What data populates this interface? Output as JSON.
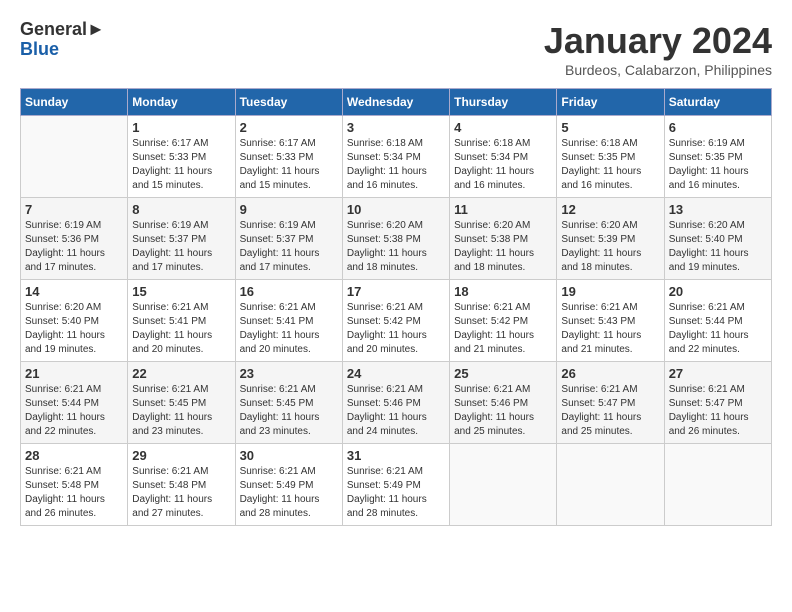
{
  "header": {
    "logo_general": "General",
    "logo_blue": "Blue",
    "month_title": "January 2024",
    "location": "Burdeos, Calabarzon, Philippines"
  },
  "days_of_week": [
    "Sunday",
    "Monday",
    "Tuesday",
    "Wednesday",
    "Thursday",
    "Friday",
    "Saturday"
  ],
  "weeks": [
    [
      {
        "day": "",
        "sunrise": "",
        "sunset": "",
        "daylight": ""
      },
      {
        "day": "1",
        "sunrise": "Sunrise: 6:17 AM",
        "sunset": "Sunset: 5:33 PM",
        "daylight": "Daylight: 11 hours and 15 minutes."
      },
      {
        "day": "2",
        "sunrise": "Sunrise: 6:17 AM",
        "sunset": "Sunset: 5:33 PM",
        "daylight": "Daylight: 11 hours and 15 minutes."
      },
      {
        "day": "3",
        "sunrise": "Sunrise: 6:18 AM",
        "sunset": "Sunset: 5:34 PM",
        "daylight": "Daylight: 11 hours and 16 minutes."
      },
      {
        "day": "4",
        "sunrise": "Sunrise: 6:18 AM",
        "sunset": "Sunset: 5:34 PM",
        "daylight": "Daylight: 11 hours and 16 minutes."
      },
      {
        "day": "5",
        "sunrise": "Sunrise: 6:18 AM",
        "sunset": "Sunset: 5:35 PM",
        "daylight": "Daylight: 11 hours and 16 minutes."
      },
      {
        "day": "6",
        "sunrise": "Sunrise: 6:19 AM",
        "sunset": "Sunset: 5:35 PM",
        "daylight": "Daylight: 11 hours and 16 minutes."
      }
    ],
    [
      {
        "day": "7",
        "sunrise": "Sunrise: 6:19 AM",
        "sunset": "Sunset: 5:36 PM",
        "daylight": "Daylight: 11 hours and 17 minutes."
      },
      {
        "day": "8",
        "sunrise": "Sunrise: 6:19 AM",
        "sunset": "Sunset: 5:37 PM",
        "daylight": "Daylight: 11 hours and 17 minutes."
      },
      {
        "day": "9",
        "sunrise": "Sunrise: 6:19 AM",
        "sunset": "Sunset: 5:37 PM",
        "daylight": "Daylight: 11 hours and 17 minutes."
      },
      {
        "day": "10",
        "sunrise": "Sunrise: 6:20 AM",
        "sunset": "Sunset: 5:38 PM",
        "daylight": "Daylight: 11 hours and 18 minutes."
      },
      {
        "day": "11",
        "sunrise": "Sunrise: 6:20 AM",
        "sunset": "Sunset: 5:38 PM",
        "daylight": "Daylight: 11 hours and 18 minutes."
      },
      {
        "day": "12",
        "sunrise": "Sunrise: 6:20 AM",
        "sunset": "Sunset: 5:39 PM",
        "daylight": "Daylight: 11 hours and 18 minutes."
      },
      {
        "day": "13",
        "sunrise": "Sunrise: 6:20 AM",
        "sunset": "Sunset: 5:40 PM",
        "daylight": "Daylight: 11 hours and 19 minutes."
      }
    ],
    [
      {
        "day": "14",
        "sunrise": "Sunrise: 6:20 AM",
        "sunset": "Sunset: 5:40 PM",
        "daylight": "Daylight: 11 hours and 19 minutes."
      },
      {
        "day": "15",
        "sunrise": "Sunrise: 6:21 AM",
        "sunset": "Sunset: 5:41 PM",
        "daylight": "Daylight: 11 hours and 20 minutes."
      },
      {
        "day": "16",
        "sunrise": "Sunrise: 6:21 AM",
        "sunset": "Sunset: 5:41 PM",
        "daylight": "Daylight: 11 hours and 20 minutes."
      },
      {
        "day": "17",
        "sunrise": "Sunrise: 6:21 AM",
        "sunset": "Sunset: 5:42 PM",
        "daylight": "Daylight: 11 hours and 20 minutes."
      },
      {
        "day": "18",
        "sunrise": "Sunrise: 6:21 AM",
        "sunset": "Sunset: 5:42 PM",
        "daylight": "Daylight: 11 hours and 21 minutes."
      },
      {
        "day": "19",
        "sunrise": "Sunrise: 6:21 AM",
        "sunset": "Sunset: 5:43 PM",
        "daylight": "Daylight: 11 hours and 21 minutes."
      },
      {
        "day": "20",
        "sunrise": "Sunrise: 6:21 AM",
        "sunset": "Sunset: 5:44 PM",
        "daylight": "Daylight: 11 hours and 22 minutes."
      }
    ],
    [
      {
        "day": "21",
        "sunrise": "Sunrise: 6:21 AM",
        "sunset": "Sunset: 5:44 PM",
        "daylight": "Daylight: 11 hours and 22 minutes."
      },
      {
        "day": "22",
        "sunrise": "Sunrise: 6:21 AM",
        "sunset": "Sunset: 5:45 PM",
        "daylight": "Daylight: 11 hours and 23 minutes."
      },
      {
        "day": "23",
        "sunrise": "Sunrise: 6:21 AM",
        "sunset": "Sunset: 5:45 PM",
        "daylight": "Daylight: 11 hours and 23 minutes."
      },
      {
        "day": "24",
        "sunrise": "Sunrise: 6:21 AM",
        "sunset": "Sunset: 5:46 PM",
        "daylight": "Daylight: 11 hours and 24 minutes."
      },
      {
        "day": "25",
        "sunrise": "Sunrise: 6:21 AM",
        "sunset": "Sunset: 5:46 PM",
        "daylight": "Daylight: 11 hours and 25 minutes."
      },
      {
        "day": "26",
        "sunrise": "Sunrise: 6:21 AM",
        "sunset": "Sunset: 5:47 PM",
        "daylight": "Daylight: 11 hours and 25 minutes."
      },
      {
        "day": "27",
        "sunrise": "Sunrise: 6:21 AM",
        "sunset": "Sunset: 5:47 PM",
        "daylight": "Daylight: 11 hours and 26 minutes."
      }
    ],
    [
      {
        "day": "28",
        "sunrise": "Sunrise: 6:21 AM",
        "sunset": "Sunset: 5:48 PM",
        "daylight": "Daylight: 11 hours and 26 minutes."
      },
      {
        "day": "29",
        "sunrise": "Sunrise: 6:21 AM",
        "sunset": "Sunset: 5:48 PM",
        "daylight": "Daylight: 11 hours and 27 minutes."
      },
      {
        "day": "30",
        "sunrise": "Sunrise: 6:21 AM",
        "sunset": "Sunset: 5:49 PM",
        "daylight": "Daylight: 11 hours and 28 minutes."
      },
      {
        "day": "31",
        "sunrise": "Sunrise: 6:21 AM",
        "sunset": "Sunset: 5:49 PM",
        "daylight": "Daylight: 11 hours and 28 minutes."
      },
      {
        "day": "",
        "sunrise": "",
        "sunset": "",
        "daylight": ""
      },
      {
        "day": "",
        "sunrise": "",
        "sunset": "",
        "daylight": ""
      },
      {
        "day": "",
        "sunrise": "",
        "sunset": "",
        "daylight": ""
      }
    ]
  ]
}
